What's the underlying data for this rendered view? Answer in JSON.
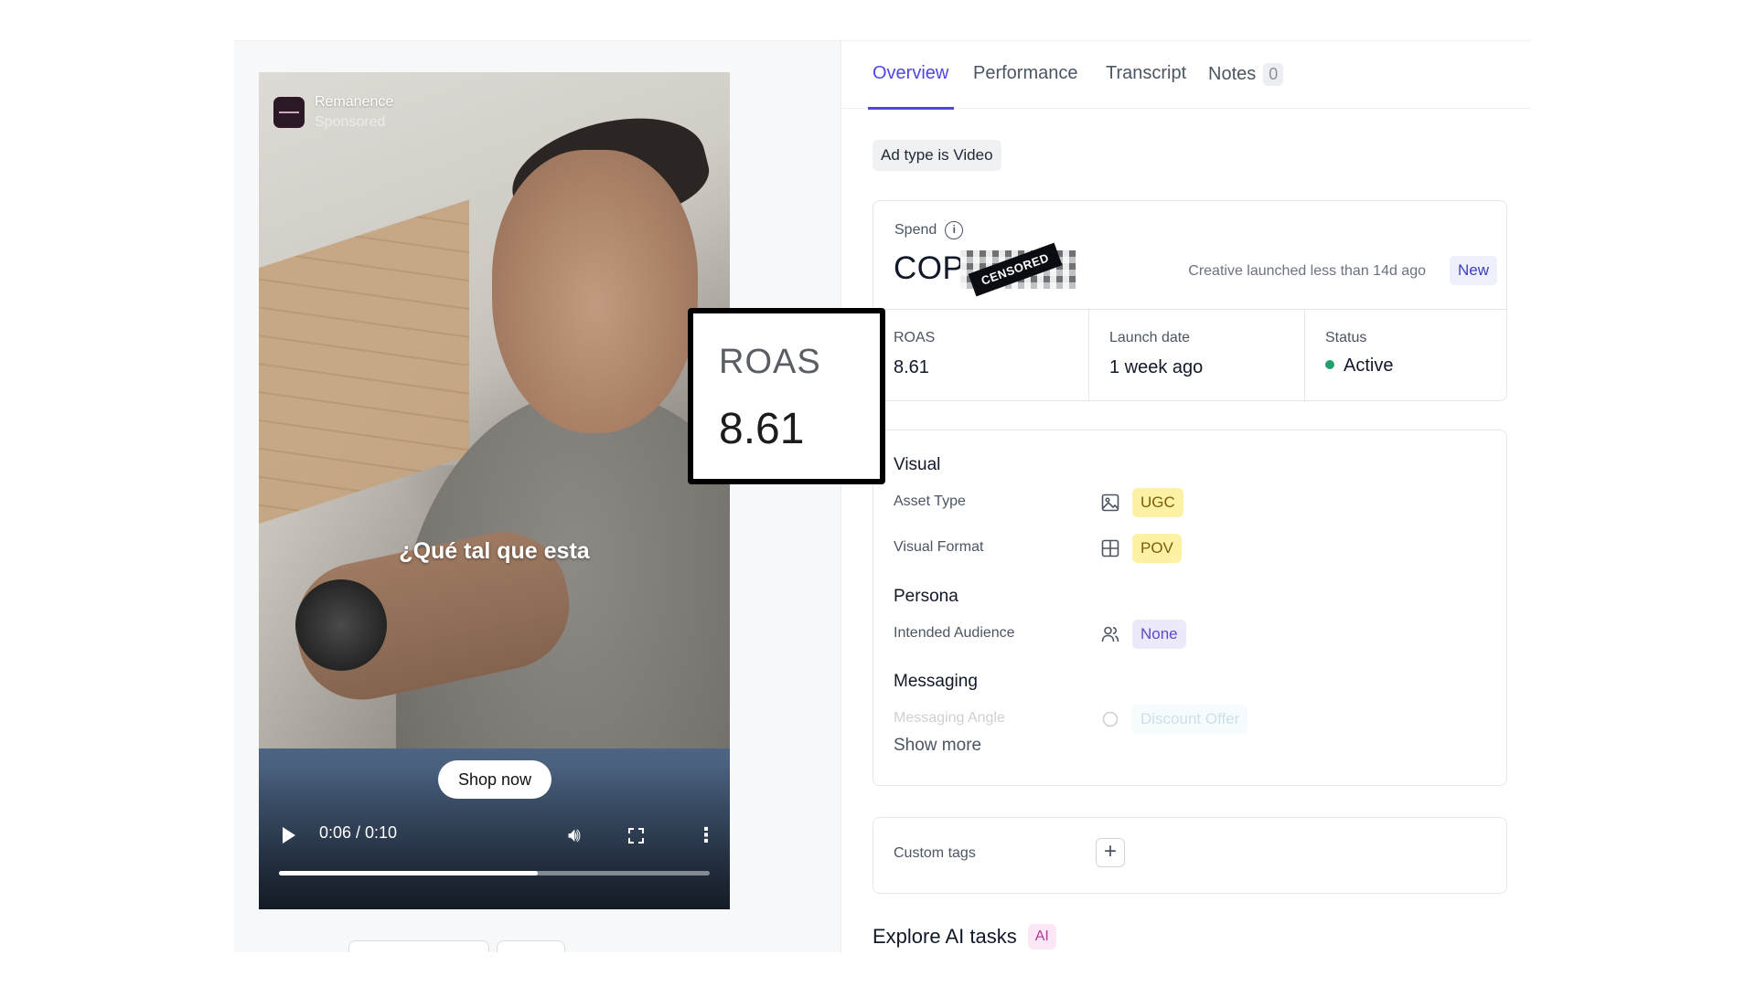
{
  "video": {
    "brand_name": "Remanence",
    "brand_subtitle": "Sponsored",
    "caption": "¿Qué tal que esta",
    "cta_label": "Shop now",
    "time_display": "0:06 / 0:10",
    "progress_fraction": 0.6,
    "icons": [
      "play-icon",
      "volume-icon",
      "fullscreen-icon",
      "more-vertical-icon"
    ]
  },
  "tabs": [
    {
      "label": "Overview",
      "active": true
    },
    {
      "label": "Performance",
      "active": false
    },
    {
      "label": "Transcript",
      "active": false
    },
    {
      "label": "Notes",
      "active": false,
      "count": "0"
    }
  ],
  "ad_type_chip": "Ad type is Video",
  "spend": {
    "label": "Spend",
    "value": "COP",
    "censored_label": "CENSORED",
    "launched_text": "Creative launched less than 14d ago",
    "new_badge": "New"
  },
  "stats": [
    {
      "label": "ROAS",
      "value": "8.61"
    },
    {
      "label": "Launch date",
      "value": "1 week ago"
    },
    {
      "label": "Status",
      "value": "Active",
      "color": "#22a06b"
    }
  ],
  "attributes": {
    "visual_title": "Visual",
    "asset_type": {
      "label": "Asset Type",
      "value": "UGC",
      "icon": "image-icon"
    },
    "visual_format": {
      "label": "Visual Format",
      "value": "POV",
      "icon": "layout-icon"
    },
    "persona_title": "Persona",
    "intended_audience": {
      "label": "Intended Audience",
      "value": "None",
      "icon": "users-icon"
    },
    "messaging_title": "Messaging",
    "messaging_angle": {
      "label": "Messaging Angle",
      "value": "Discount Offer",
      "icon": "circle-icon"
    },
    "show_more": "Show more"
  },
  "custom_tags": {
    "label": "Custom tags",
    "add": "+"
  },
  "explore": {
    "title": "Explore AI tasks",
    "badge": "AI"
  },
  "roas_callout": {
    "label": "ROAS",
    "value": "8.61"
  },
  "colors": {
    "accent": "#4f46e5",
    "status_active": "#22a06b",
    "tag_yellow": "#fdf1a6",
    "tag_purple": "#ece9fb"
  }
}
